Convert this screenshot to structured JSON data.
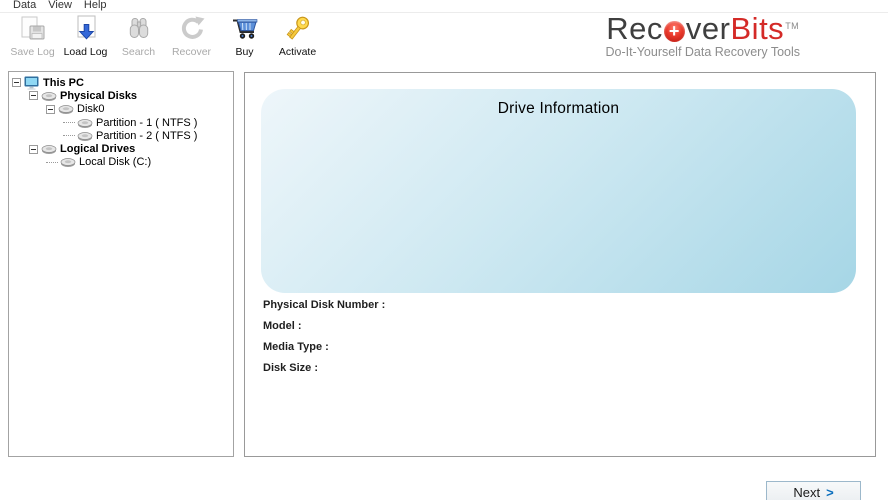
{
  "menu": {
    "items": [
      "Data",
      "View",
      "Help"
    ]
  },
  "toolbar": {
    "buttons": [
      {
        "label": "Save Log",
        "icon": "save-icon",
        "enabled": false
      },
      {
        "label": "Load Log",
        "icon": "load-document-icon",
        "enabled": true
      },
      {
        "label": "Search",
        "icon": "binoculars-icon",
        "enabled": false
      },
      {
        "label": "Recover",
        "icon": "recover-arrow-icon",
        "enabled": false
      },
      {
        "label": "Buy",
        "icon": "shopping-cart-icon",
        "enabled": true
      },
      {
        "label": "Activate",
        "icon": "key-icon",
        "enabled": true
      }
    ]
  },
  "brand": {
    "name_prefix": "Rec",
    "name_plus": "+",
    "name_mid": "ver",
    "name_suffix": "Bits",
    "trademark": "TM",
    "tagline": "Do-It-Yourself Data Recovery Tools"
  },
  "tree": {
    "items": [
      {
        "label": "This PC",
        "depth": 0,
        "bold": true,
        "icon": "computer-icon",
        "expanded": true
      },
      {
        "label": "Physical Disks",
        "depth": 1,
        "bold": true,
        "icon": "disk-icon",
        "expanded": true
      },
      {
        "label": "Disk0",
        "depth": 2,
        "bold": false,
        "icon": "disk-icon",
        "expanded": true
      },
      {
        "label": "Partition - 1 ( NTFS )",
        "depth": 3,
        "bold": false,
        "icon": "disk-icon",
        "expanded": null
      },
      {
        "label": "Partition - 2 ( NTFS )",
        "depth": 3,
        "bold": false,
        "icon": "disk-icon",
        "expanded": null
      },
      {
        "label": "Logical Drives",
        "depth": 1,
        "bold": true,
        "icon": "disk-icon",
        "expanded": true
      },
      {
        "label": "Local Disk (C:)",
        "depth": 2,
        "bold": false,
        "icon": "disk-icon",
        "expanded": null
      }
    ]
  },
  "main": {
    "panel_title": "Drive Information",
    "field_labels": [
      "Physical Disk Number :",
      "Model :",
      "Media Type :",
      "Disk Size :"
    ]
  },
  "footer": {
    "next_label": "Next",
    "next_arrow": ">"
  },
  "colors": {
    "brand_red": "#d42a27",
    "brand_text": "#3f3f3f",
    "drive_box_gradient_start": "#eef6fa",
    "drive_box_gradient_end": "#a6d6e6",
    "next_arrow_blue": "#0a6ebd"
  }
}
